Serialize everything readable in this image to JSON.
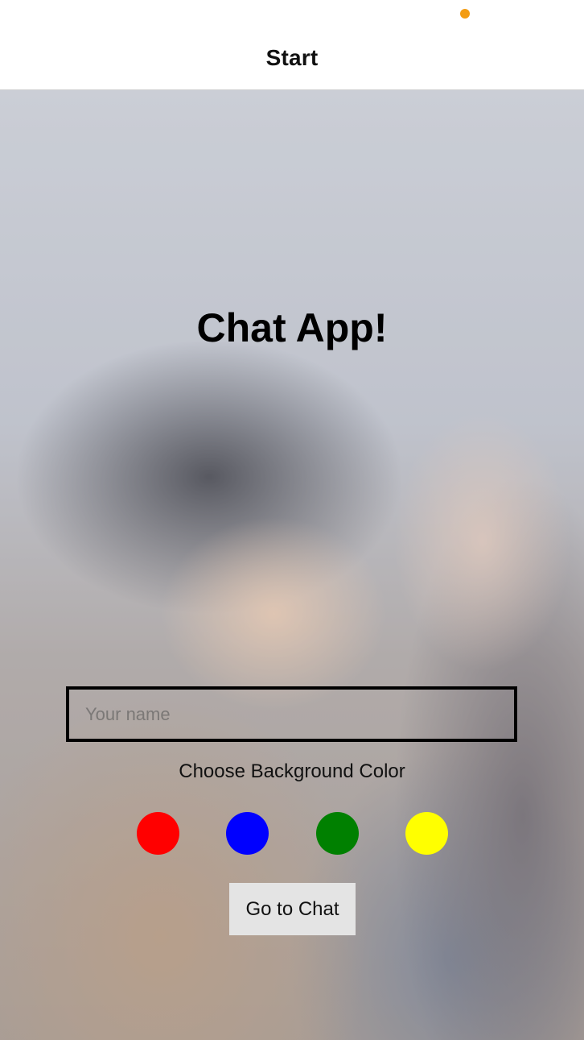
{
  "nav": {
    "title": "Start"
  },
  "main": {
    "title": "Chat App!",
    "name_input": {
      "placeholder": "Your name",
      "value": ""
    },
    "color_label": "Choose Background Color",
    "colors": [
      {
        "name": "red",
        "hex": "#ff0000"
      },
      {
        "name": "blue",
        "hex": "#0000ff"
      },
      {
        "name": "green",
        "hex": "#008000"
      },
      {
        "name": "yellow",
        "hex": "#ffff00"
      }
    ],
    "chat_button": "Go to Chat"
  },
  "colors": {
    "status_dot": "#f39c12",
    "button_bg": "#e4e4e4"
  }
}
